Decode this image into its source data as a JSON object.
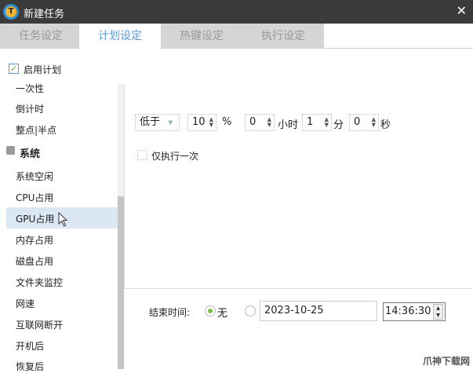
{
  "window": {
    "title": "新建任务",
    "close": "✕"
  },
  "tabs": [
    {
      "label": "任务设定"
    },
    {
      "label": "计划设定"
    },
    {
      "label": "热键设定"
    },
    {
      "label": "执行设定"
    }
  ],
  "sidebar": {
    "enable_label": "启用计划",
    "enabled": true,
    "items": [
      "一次性",
      "倒计时",
      "整点|半点"
    ],
    "group_label": "系统",
    "group_items": [
      "系统空闲",
      "CPU占用",
      "GPU占用",
      "内存占用",
      "磁盘占用",
      "文件夹监控",
      "网速",
      "互联网断开",
      "开机后",
      "恢复后"
    ],
    "selected": "GPU占用"
  },
  "condition": {
    "compare": "低于",
    "percent": "10",
    "percent_unit": "%",
    "hours": "0",
    "hours_unit": "小时",
    "minutes": "1",
    "minutes_unit": "分",
    "seconds": "0",
    "seconds_unit": "秒"
  },
  "once": {
    "label": "仅执行一次",
    "checked": false
  },
  "end_time": {
    "label": "结束时间:",
    "none_label": "无",
    "none_selected": true,
    "date": "2023-10-25",
    "time": "14:36:30"
  },
  "watermark": "爪神下载网"
}
